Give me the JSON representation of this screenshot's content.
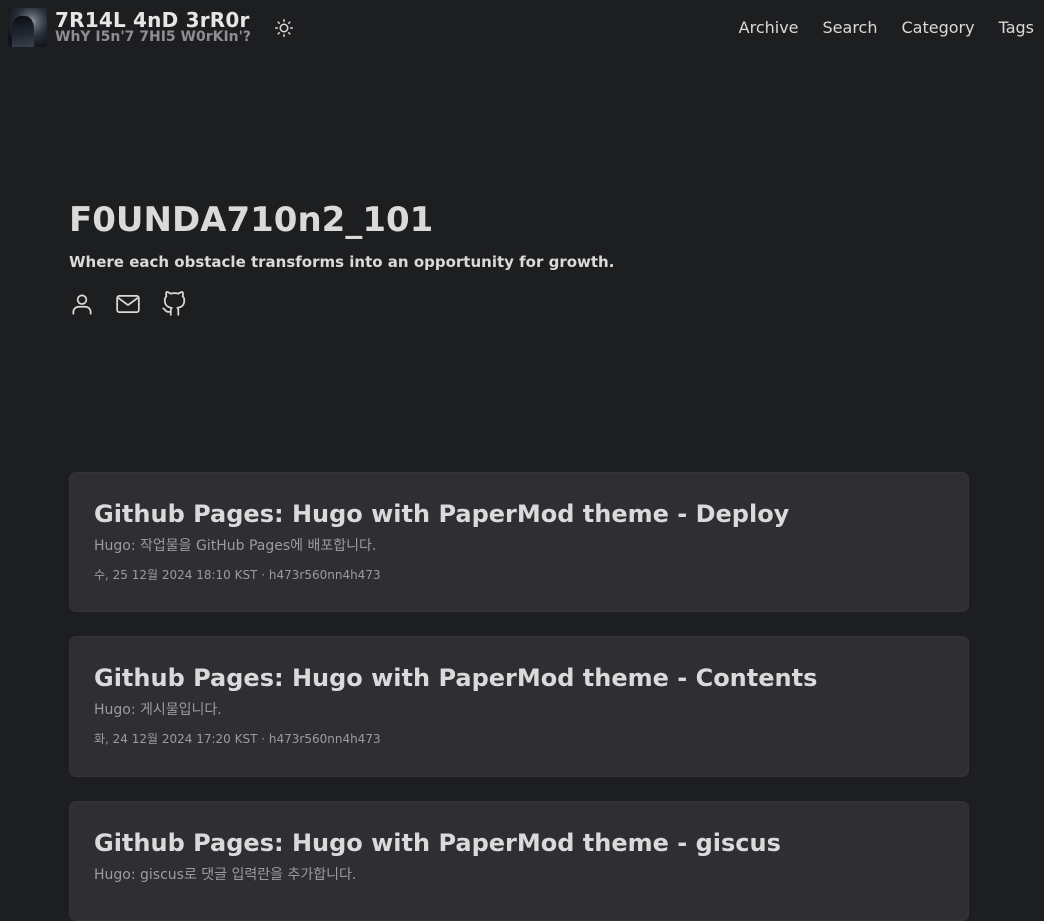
{
  "header": {
    "title": "7R14L 4nD 3rR0r",
    "subtitle": "WhY I5n'7 7HI5 W0rKIn'?",
    "avatar_icon": "avatar-image",
    "theme_toggle_icon": "sun-icon",
    "menu": [
      {
        "label": "Archive"
      },
      {
        "label": "Search"
      },
      {
        "label": "Category"
      },
      {
        "label": "Tags"
      }
    ]
  },
  "home": {
    "title": "F0UNDA710n2_101",
    "description": "Where each obstacle transforms into an opportunity for growth.",
    "social_icons": [
      "user-icon",
      "mail-icon",
      "github-icon"
    ]
  },
  "posts": [
    {
      "title": "Github Pages: Hugo with PaperMod theme - Deploy",
      "summary": "Hugo: 작업물을 GitHub Pages에 배포합니다.",
      "meta": "수, 25 12월 2024 18:10 KST · h473r560nn4h473"
    },
    {
      "title": "Github Pages: Hugo with PaperMod theme - Contents",
      "summary": "Hugo: 게시물입니다.",
      "meta": "화, 24 12월 2024 17:20 KST · h473r560nn4h473"
    },
    {
      "title": "Github Pages: Hugo with PaperMod theme - giscus",
      "summary": "Hugo: giscus로 댓글 입력란을 추가합니다.",
      "meta": ""
    }
  ],
  "colors": {
    "background": "#1d1e20",
    "card": "#2e2e33",
    "text": "#dadadb",
    "secondary": "#9b9c9d"
  }
}
